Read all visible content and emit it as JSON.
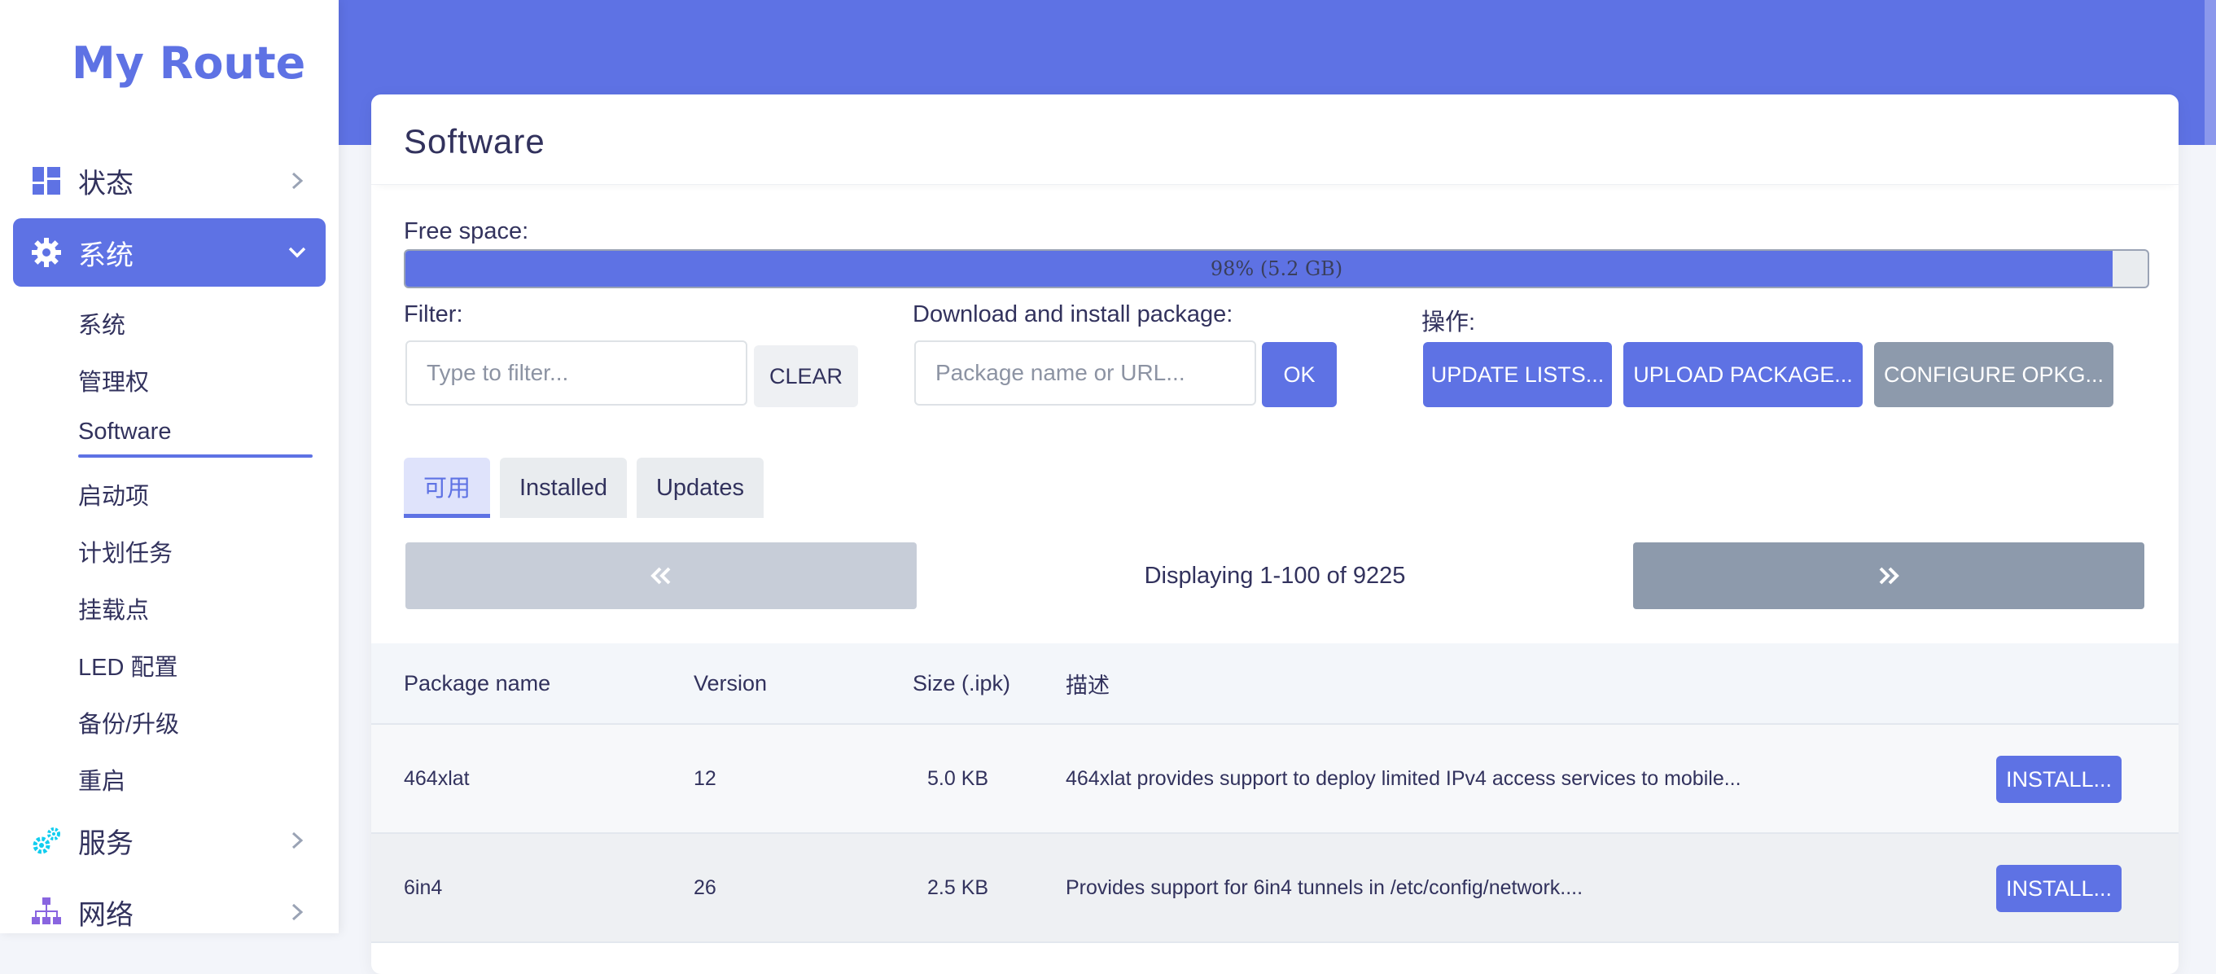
{
  "colors": {
    "accent": "#5e72e4",
    "slate": "#8d9aac",
    "pager_disabled": "#c7cdd8"
  },
  "brand": "My Route",
  "sidebar": {
    "status": {
      "label": "状态",
      "icon": "dashboard-icon"
    },
    "system": {
      "label": "系统",
      "icon": "gear-icon"
    },
    "system_items": [
      "系统",
      "管理权",
      "Software",
      "启动项",
      "计划任务",
      "挂载点",
      "LED 配置",
      "备份/升级",
      "重启"
    ],
    "current_item": "Software",
    "services": {
      "label": "服务",
      "icon": "gears-icon"
    },
    "network": {
      "label": "网络",
      "icon": "network-icon"
    }
  },
  "page": {
    "title": "Software",
    "free_space_label": "Free space:",
    "free_space_text": "98% (5.2 GB)",
    "free_space_fraction": 0.98,
    "filter_label": "Filter:",
    "filter_placeholder": "Type to filter...",
    "clear_label": "CLEAR",
    "download_label": "Download and install package:",
    "download_placeholder": "Package name or URL...",
    "ok_label": "OK",
    "actions_label": "操作:",
    "update_lists_label": "UPDATE LISTS...",
    "upload_package_label": "UPLOAD PACKAGE...",
    "configure_opkg_label": "CONFIGURE OPKG...",
    "tabs": [
      "可用",
      "Installed",
      "Updates"
    ],
    "active_tab": "可用",
    "pager_prev": "«",
    "pager_next": "»",
    "pager_text": "Displaying 1-100 of 9225"
  },
  "table": {
    "headers": [
      "Package name",
      "Version",
      "Size (.ipk)",
      "描述"
    ],
    "rows": [
      {
        "name": "464xlat",
        "version": "12",
        "size": "5.0 KB",
        "desc": "464xlat provides support to deploy limited IPv4 access services to mobile...",
        "action": "INSTALL..."
      },
      {
        "name": "6in4",
        "version": "26",
        "size": "2.5 KB",
        "desc": "Provides support for 6in4 tunnels in /etc/config/network....",
        "action": "INSTALL..."
      }
    ]
  }
}
